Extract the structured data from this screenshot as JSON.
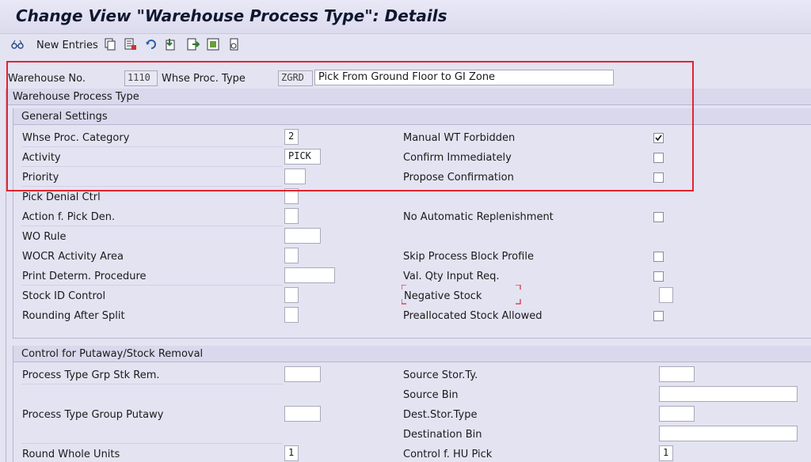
{
  "title": "Change View \"Warehouse Process Type\": Details",
  "toolbar": {
    "new_entries_label": "New Entries",
    "icons": [
      "glasses-icon",
      "copy-icon",
      "delete-icon",
      "undo-icon",
      "export-icon",
      "next-icon",
      "select-icon",
      "print-icon"
    ]
  },
  "header": {
    "warehouse_no_label": "Warehouse No.",
    "warehouse_no_value": "1110",
    "whse_proc_type_label": "Whse Proc. Type",
    "whse_proc_type_value": "ZGRD",
    "whse_proc_type_desc": "Pick From Ground Floor to GI Zone"
  },
  "section_main": {
    "title": "Warehouse Process Type"
  },
  "general": {
    "title": "General Settings",
    "category_label": "Whse Proc. Category",
    "category_value": "2",
    "activity_label": "Activity",
    "activity_value": "PICK",
    "priority_label": "Priority",
    "priority_value": "",
    "pick_denial_label": "Pick Denial Ctrl",
    "action_pick_den_label": "Action f. Pick Den.",
    "wo_rule_label": "WO Rule",
    "wocr_label": "WOCR Activity Area",
    "print_determ_label": "Print Determ. Procedure",
    "stock_id_label": "Stock ID Control",
    "rounding_label": "Rounding After Split",
    "manual_wt_label": "Manual WT Forbidden",
    "manual_wt_checked": true,
    "confirm_imm_label": "Confirm Immediately",
    "propose_conf_label": "Propose Confirmation",
    "no_auto_repl_label": "No Automatic Replenishment",
    "skip_block_label": "Skip Process Block Profile",
    "val_qty_label": "Val. Qty Input Req.",
    "neg_stock_label": "Negative Stock",
    "prealloc_label": "Preallocated Stock Allowed"
  },
  "control": {
    "title": "Control for Putaway/Stock Removal",
    "ptg_stk_rem_label": "Process Type Grp Stk Rem.",
    "ptg_putawy_label": "Process Type Group Putawy",
    "round_whole_label": "Round Whole Units",
    "round_whole_value": "1",
    "source_stor_label": "Source Stor.Ty.",
    "source_bin_label": "Source Bin",
    "dest_stor_label": "Dest.Stor.Type",
    "dest_bin_label": "Destination Bin",
    "hu_pick_label": "Control f. HU Pick",
    "hu_pick_value": "1"
  },
  "colors": {
    "highlight": "#e4232f",
    "background": "#e4e3f2"
  }
}
